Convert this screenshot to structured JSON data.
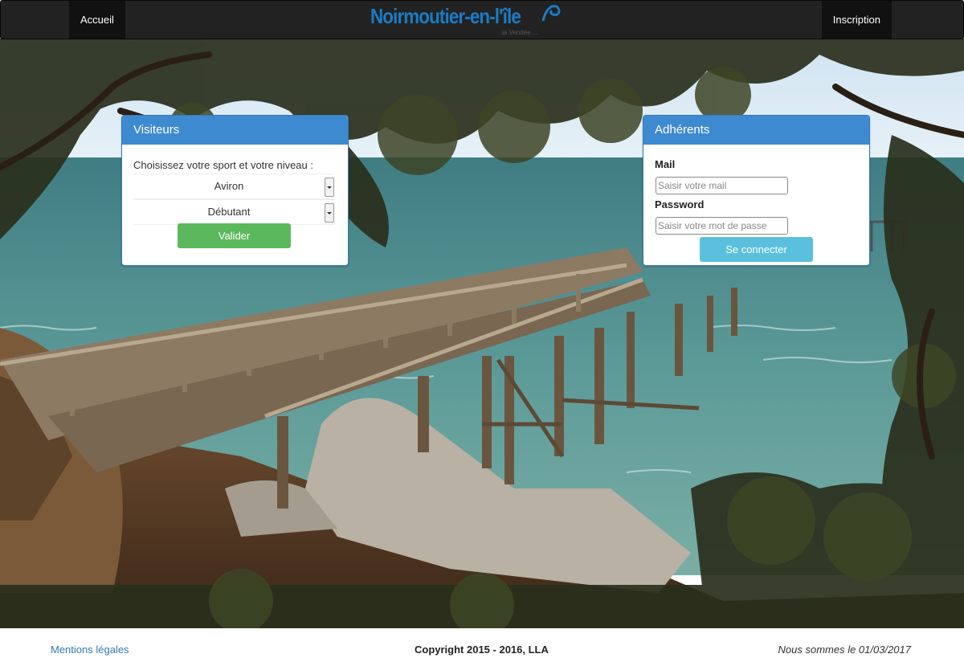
{
  "navbar": {
    "home_label": "Accueil",
    "brand_title": "Noirmoutier-en-l'île",
    "brand_subtitle": "la Vendée ...",
    "signup_label": "Inscription"
  },
  "visitors_panel": {
    "title": "Visiteurs",
    "prompt": "Choisissez votre sport et votre niveau :",
    "sport_value": "Aviron",
    "level_value": "Débutant",
    "submit_label": "Valider"
  },
  "members_panel": {
    "title": "Adhérents",
    "mail_label": "Mail",
    "mail_placeholder": "Saisir votre mail",
    "password_label": "Password",
    "password_placeholder": "Saisir votre mot de passe",
    "login_label": "Se connecter"
  },
  "footer": {
    "legal_link": "Mentions légales",
    "copyright": "Copyright 2015 - 2016, LLA",
    "date_text": "Nous sommes le 01/03/2017"
  },
  "colors": {
    "navbar_bg": "#222222",
    "panel_heading": "#3e8ad0",
    "valider_button": "#5cb85c",
    "connect_button": "#5bc0de",
    "brand": "#1b7bc4"
  },
  "icons": [
    "wave-logo-icon",
    "select-arrow-icon"
  ]
}
